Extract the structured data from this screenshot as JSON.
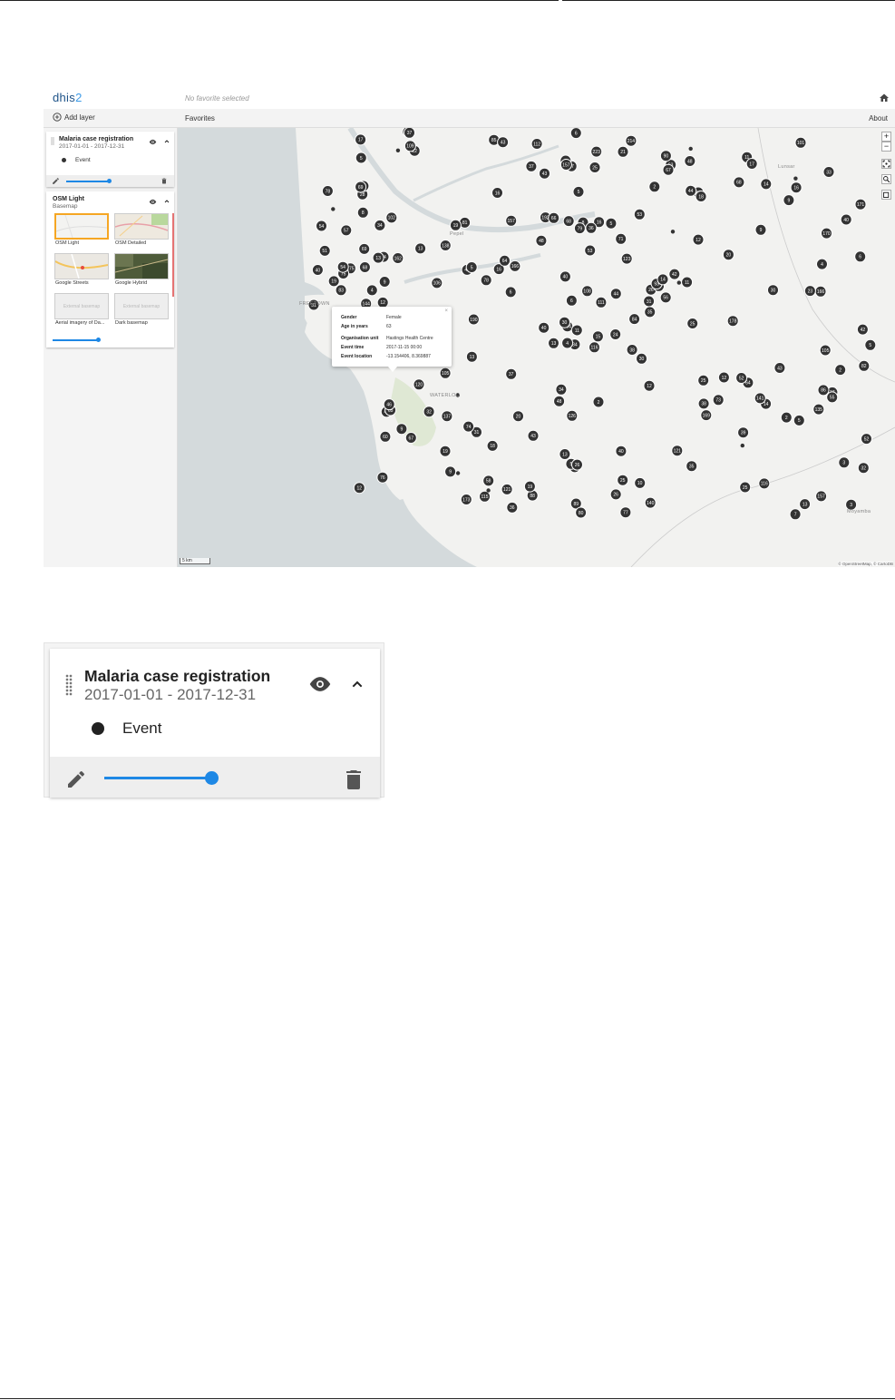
{
  "header": {
    "logo_main": "dhis",
    "logo_accent": "2",
    "favorite_title": "No favorite selected",
    "home_icon": "home-icon"
  },
  "toolbar": {
    "add_layer_label": "Add layer",
    "favorites_label": "Favorites",
    "about_label": "About"
  },
  "layers": [
    {
      "title": "Malaria case registration",
      "period": "2017-01-01 - 2017-12-31",
      "legend_label": "Event",
      "opacity": 0.75
    },
    {
      "title": "OSM Light",
      "subtitle": "Basemap",
      "opacity": 0.75,
      "basemaps": [
        {
          "label": "OSM Light",
          "selected": true,
          "placeholder": ""
        },
        {
          "label": "OSM Detailed",
          "selected": false,
          "placeholder": ""
        },
        {
          "label": "Google Streets",
          "selected": false,
          "placeholder": ""
        },
        {
          "label": "Google Hybrid",
          "selected": false,
          "placeholder": ""
        },
        {
          "label": "Aerial imagery of Da...",
          "selected": false,
          "placeholder": "External basemap"
        },
        {
          "label": "Dark basemap",
          "selected": false,
          "placeholder": "External basemap"
        }
      ]
    }
  ],
  "map": {
    "zoom_in": "+",
    "zoom_out": "−",
    "scale_label": "5 km",
    "attribution": "© OpenStreetMap, © CartoDB",
    "place_labels": [
      "FREETOWN",
      "WATERLOO",
      "Lunsar",
      "Moyamba",
      "Pepel"
    ],
    "cluster_counts": [
      "116",
      "34",
      "104",
      "26",
      "31",
      "48",
      "16",
      "40",
      "84",
      "22",
      "3",
      "12",
      "171",
      "13",
      "12",
      "68",
      "123",
      "9",
      "166",
      "12",
      "9",
      "8",
      "67",
      "64",
      "102",
      "17",
      "83",
      "25",
      "6",
      "30",
      "13",
      "6",
      "81",
      "68",
      "74",
      "13",
      "3",
      "52",
      "214",
      "16",
      "106",
      "169",
      "173",
      "40",
      "31",
      "81",
      "35",
      "60",
      "170",
      "78",
      "73",
      "35",
      "19",
      "109",
      "17",
      "40",
      "16",
      "223",
      "190",
      "175",
      "138",
      "14",
      "4",
      "63",
      "43",
      "108",
      "126",
      "121",
      "12",
      "46",
      "5",
      "13",
      "40",
      "25",
      "44",
      "76",
      "25",
      "18",
      "89",
      "166",
      "2",
      "116",
      "77",
      "121",
      "7",
      "5",
      "11",
      "39",
      "111",
      "135",
      "75",
      "80",
      "44",
      "18",
      "85",
      "42",
      "19",
      "120",
      "137",
      "58",
      "93",
      "9",
      "6",
      "105",
      "28",
      "36",
      "40",
      "43",
      "34",
      "33",
      "192",
      "112",
      "45",
      "101",
      "71",
      "157",
      "178",
      "105",
      "157",
      "88",
      "30",
      "8",
      "65",
      "140",
      "5",
      "16",
      "2",
      "14",
      "13",
      "46",
      "82",
      "64",
      "38",
      "9",
      "2",
      "24",
      "14",
      "5",
      "19",
      "25",
      "5",
      "157",
      "4",
      "19",
      "54",
      "36",
      "43",
      "21",
      "5",
      "53",
      "53",
      "12",
      "25",
      "6",
      "67",
      "69",
      "34",
      "32",
      "37",
      "7",
      "5",
      "10",
      "51",
      "90",
      "42",
      "115",
      "2",
      "38",
      "54",
      "34",
      "57",
      "15",
      "26",
      "68",
      "69",
      "162",
      "13",
      "4",
      "18",
      "11",
      "86",
      "20",
      "79",
      "9",
      "56",
      "26",
      "66",
      "141",
      "32",
      "11",
      "48",
      "31",
      "20",
      "4",
      "48",
      "17",
      "52",
      "40",
      "78",
      "55",
      "23",
      "43",
      "67",
      "30",
      "37",
      "144",
      "37",
      "5"
    ]
  },
  "popup": {
    "rows": [
      {
        "label": "Gender",
        "value": "Female"
      },
      {
        "label": "Age in years",
        "value": "63"
      },
      {
        "label": "Organisation unit",
        "value": "Hastings Health Centre"
      },
      {
        "label": "Event time",
        "value": "2017-11-15 00:00"
      },
      {
        "label": "Event location",
        "value": "-13.154406, 8.369887"
      }
    ],
    "close": "×"
  },
  "zoomed_card": {
    "title": "Malaria case registration",
    "period": "2017-01-01 - 2017-12-31",
    "legend_label": "Event",
    "opacity": 0.75
  },
  "colors": {
    "accent": "#1e88e5",
    "cluster": "#333333",
    "sea": "#d4dadc",
    "land": "#f2f2f0",
    "selected_border": "#f5a623"
  }
}
